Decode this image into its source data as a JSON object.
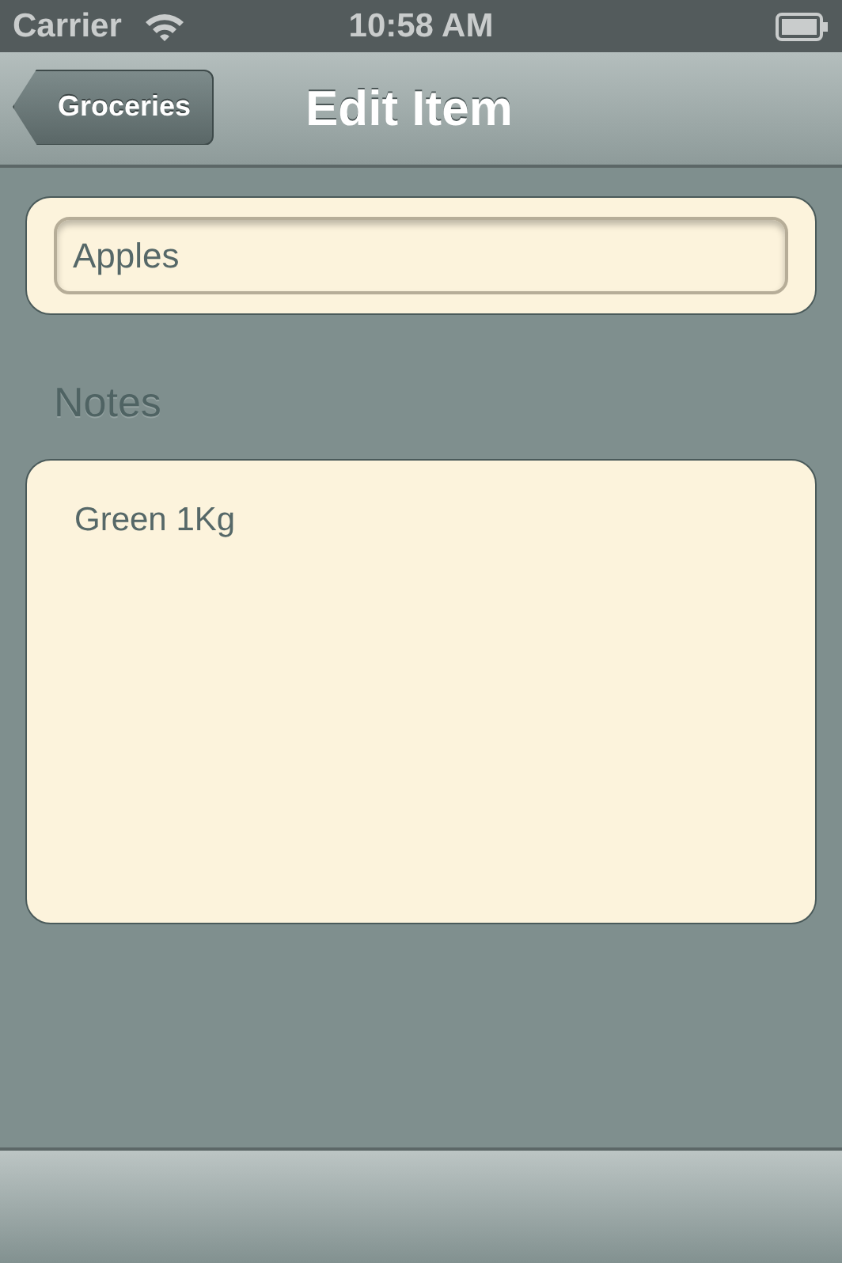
{
  "status_bar": {
    "carrier": "Carrier",
    "time": "10:58 AM"
  },
  "nav_bar": {
    "back_button": "Groceries",
    "title": "Edit Item"
  },
  "name_field": {
    "value": "Apples"
  },
  "notes": {
    "label": "Notes",
    "value": "Green 1Kg"
  }
}
